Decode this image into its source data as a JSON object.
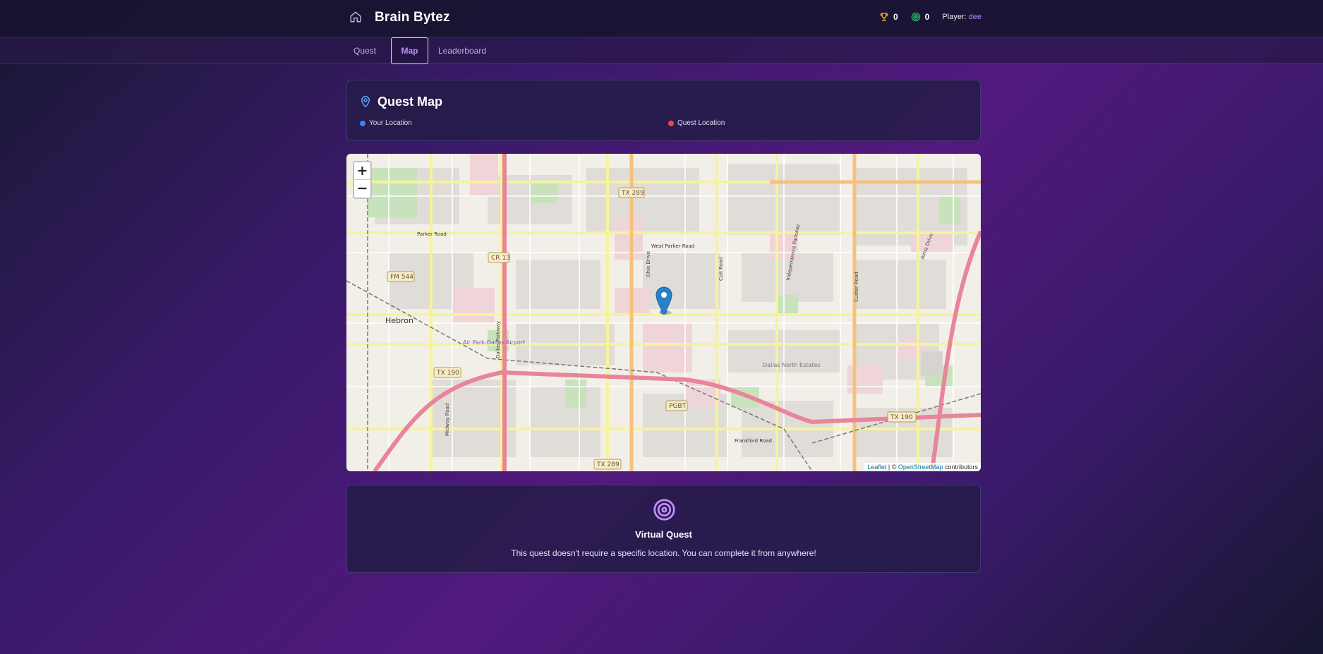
{
  "header": {
    "title": "Brain Bytez",
    "stats": {
      "trophies": "0",
      "targets": "0"
    },
    "player_label": "Player:",
    "player_name": "dee"
  },
  "tabs": [
    {
      "label": "Quest",
      "active": false
    },
    {
      "label": "Map",
      "active": true
    },
    {
      "label": "Leaderboard",
      "active": false
    }
  ],
  "quest_map": {
    "title": "Quest Map",
    "legend": [
      {
        "label": "Your Location",
        "color": "#3b82f6"
      },
      {
        "label": "Quest Location",
        "color": "#ef4444"
      }
    ]
  },
  "map": {
    "zoom_in": "+",
    "zoom_out": "−",
    "labels": {
      "hebron": "Hebron",
      "airport": "Air Park-Dallas Airport",
      "dallas_north_estates": "Dallas North Estates",
      "west_parker_road": "West Parker Road",
      "parker_road": "Parker Road",
      "frankford_road": "Frankford Road",
      "ohio_drive": "Ohio Drive",
      "coit_road": "Coit Road",
      "custer_road": "Custer Road",
      "independence_parkway": "Independence Parkway",
      "dallas_parkway": "Dallas Parkway",
      "midway_road": "Midway Road",
      "alma_drive": "Alma Drive"
    },
    "shields": {
      "tx289_top": "TX 289",
      "tx289_bottom": "TX 289",
      "cr13": "CR 13",
      "fm544": "FM 544",
      "tx190_left": "TX 190",
      "tx190_right": "TX 190",
      "pgbt": "PGBT"
    },
    "attribution": {
      "leaflet": "Leaflet",
      "separator": "| ©",
      "osm": "OpenStreetMap",
      "contributors": "contributors"
    }
  },
  "virtual_quest": {
    "title": "Virtual Quest",
    "description": "This quest doesn't require a specific location. You can complete it from anywhere!"
  },
  "colors": {
    "accent": "#c58cff",
    "trophy": "#f5b82e",
    "target": "#22c55e",
    "marker": "#2a81cb"
  }
}
